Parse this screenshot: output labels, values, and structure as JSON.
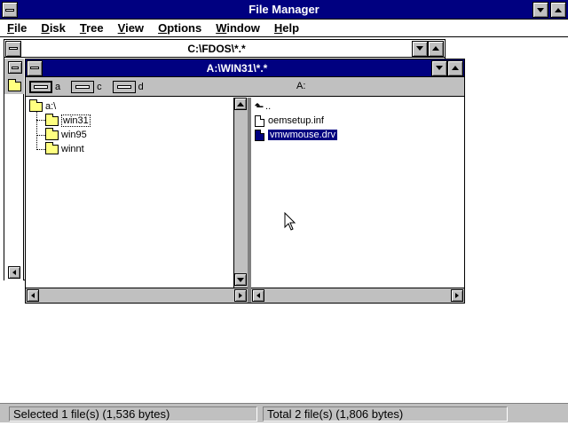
{
  "app": {
    "title": "File Manager"
  },
  "menu": [
    {
      "key": "F",
      "rest": "ile"
    },
    {
      "key": "D",
      "rest": "isk"
    },
    {
      "key": "T",
      "rest": "ree"
    },
    {
      "key": "V",
      "rest": "iew"
    },
    {
      "key": "O",
      "rest": "ptions"
    },
    {
      "key": "W",
      "rest": "indow"
    },
    {
      "key": "H",
      "rest": "elp"
    }
  ],
  "back_window": {
    "title": "C:\\FDOS\\*.*"
  },
  "front_window": {
    "title": "A:\\WIN31\\*.*",
    "drives": [
      {
        "letter": "a",
        "type": "floppy-drive-icon",
        "selected": true
      },
      {
        "letter": "c",
        "type": "hard-drive-icon",
        "selected": false
      },
      {
        "letter": "d",
        "type": "cdrom-drive-icon",
        "selected": false
      }
    ],
    "current_drive": "A:",
    "tree": [
      {
        "label": "a:\\",
        "icon": "open-folder-icon",
        "level": 0,
        "selected": false
      },
      {
        "label": "win31",
        "icon": "open-folder-icon",
        "level": 1,
        "selected": true
      },
      {
        "label": "win95",
        "icon": "folder-icon",
        "level": 1,
        "selected": false
      },
      {
        "label": "winnt",
        "icon": "folder-icon",
        "level": 1,
        "selected": false
      }
    ],
    "files": [
      {
        "label": "..",
        "icon": "parent-dir-icon",
        "selected": false
      },
      {
        "label": "oemsetup.inf",
        "icon": "file-icon",
        "selected": false
      },
      {
        "label": "vmwmouse.drv",
        "icon": "file-icon",
        "selected": true
      }
    ]
  },
  "status": {
    "selected": "Selected 1 file(s) (1,536 bytes)",
    "total": "Total 2 file(s) (1,806 bytes)"
  },
  "colors": {
    "titlebar_active": "#000080",
    "face": "#c0c0c0",
    "folder": "#ffff80"
  }
}
